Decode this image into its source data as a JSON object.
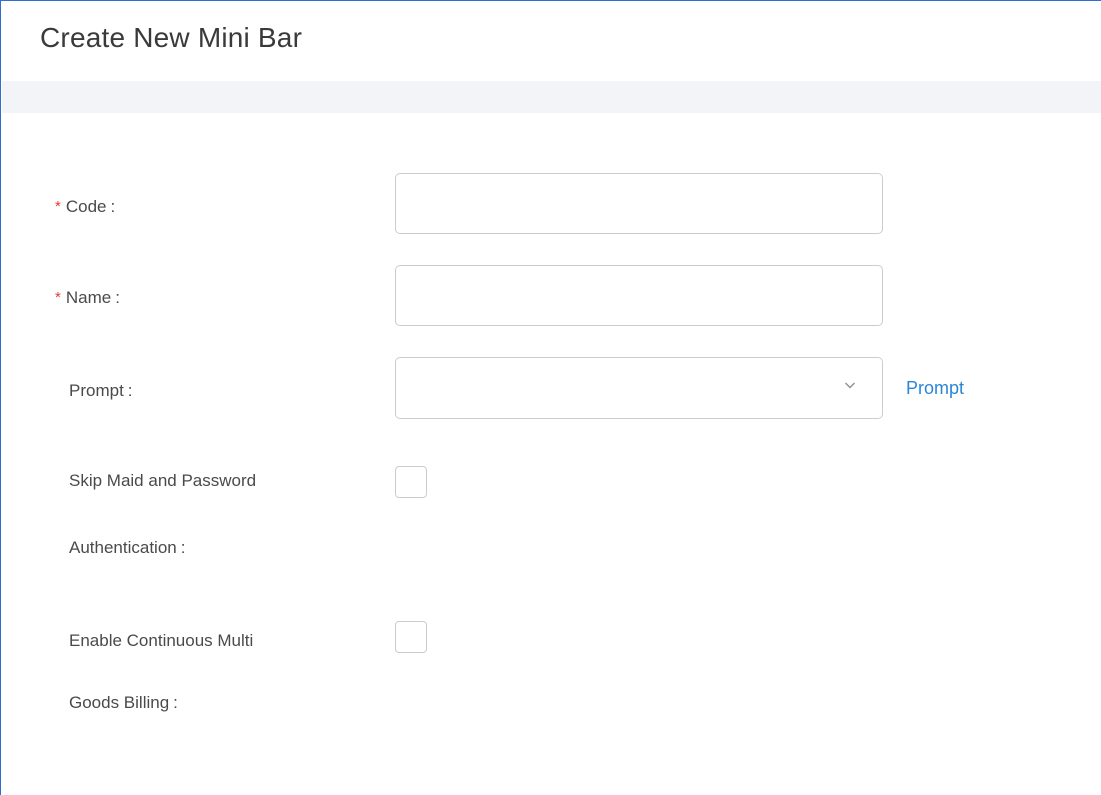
{
  "header": {
    "title": "Create New Mini Bar"
  },
  "form": {
    "code": {
      "required_mark": "*",
      "label": "Code",
      "colon": ":",
      "value": "",
      "placeholder": ""
    },
    "name": {
      "required_mark": "*",
      "label": "Name",
      "colon": ":",
      "value": "",
      "placeholder": ""
    },
    "prompt": {
      "label": "Prompt",
      "colon": ":",
      "selected_value": "",
      "link_label": "Prompt",
      "icon": "chevron-down-icon"
    },
    "skip_maid_auth": {
      "label_line1": "Skip Maid and Password",
      "label_line2": "Authentication",
      "colon": ":",
      "checked": false
    },
    "continuous_billing": {
      "label_line1": "Enable Continuous Multi",
      "label_line2": "Goods Billing",
      "colon": ":",
      "checked": false
    }
  },
  "colors": {
    "required": "#e33a3a",
    "link": "#2a86d6",
    "frame_border": "#2f6fd0",
    "header_strip": "#f2f4f7"
  }
}
